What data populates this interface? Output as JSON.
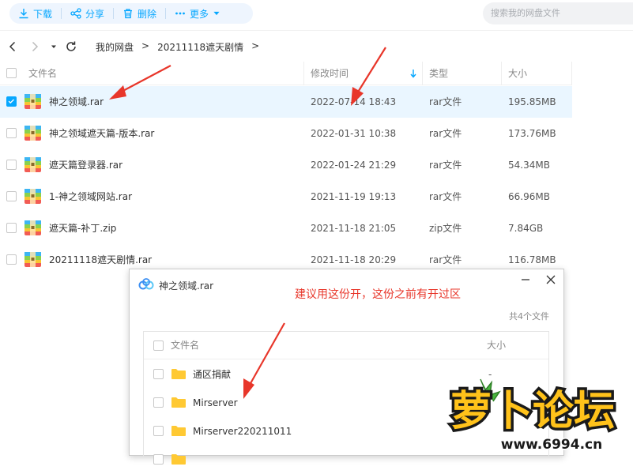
{
  "toolbar": {
    "download": "下载",
    "share": "分享",
    "delete": "删除",
    "more": "更多",
    "search_placeholder": "搜索我的网盘文件"
  },
  "breadcrumb": [
    "我的网盘",
    ">",
    "20211118遮天剧情",
    ">"
  ],
  "columns": {
    "name": "文件名",
    "modified": "修改时间",
    "type": "类型",
    "size": "大小"
  },
  "files": [
    {
      "name": "神之领域.rar",
      "time": "2022-07-14 18:43",
      "type": "rar文件",
      "size": "195.85MB",
      "selected": true
    },
    {
      "name": "神之领域遮天篇-版本.rar",
      "time": "2022-01-31 10:38",
      "type": "rar文件",
      "size": "173.76MB",
      "selected": false
    },
    {
      "name": "遮天篇登录器.rar",
      "time": "2022-01-24 21:29",
      "type": "rar文件",
      "size": "54.34MB",
      "selected": false
    },
    {
      "name": "1-神之领域网站.rar",
      "time": "2021-11-19 19:13",
      "type": "rar文件",
      "size": "66.96MB",
      "selected": false
    },
    {
      "name": "遮天篇-补丁.zip",
      "time": "2021-11-18 21:05",
      "type": "zip文件",
      "size": "7.84GB",
      "selected": false
    },
    {
      "name": "20211118遮天剧情.rar",
      "time": "2021-11-18 20:29",
      "type": "rar文件",
      "size": "116.78MB",
      "selected": false
    }
  ],
  "dialog": {
    "title": "神之领域.rar",
    "note": "建议用这份开，这份之前有开过区",
    "count": "共4个文件",
    "col_name": "文件名",
    "col_size": "大小",
    "items": [
      {
        "name": "通区捐献",
        "size": "-"
      },
      {
        "name": "Mirserver",
        "size": ""
      },
      {
        "name": "Mirserver220211011",
        "size": ""
      }
    ]
  },
  "watermark": {
    "text": "萝卜论坛",
    "url": "www.6994.cn"
  },
  "colors": {
    "accent": "#06a7ff",
    "annotation": "#e8362a",
    "selected_row": "#eaf6ff"
  }
}
